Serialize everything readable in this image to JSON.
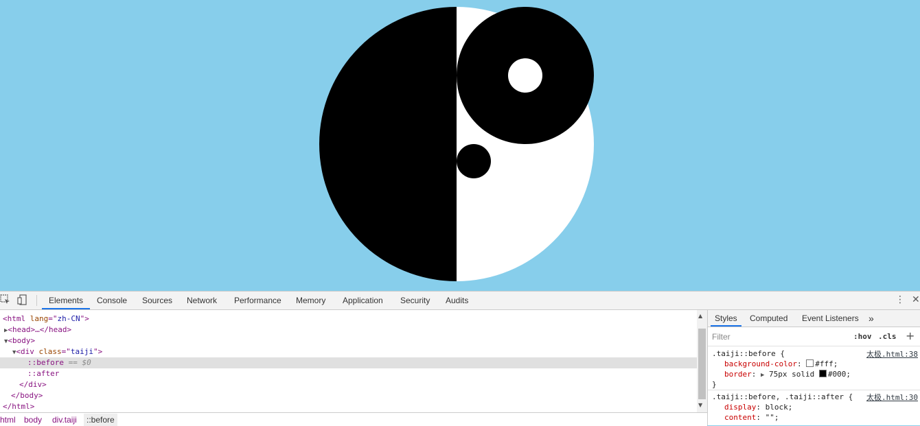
{
  "page": {
    "background_color": "#87ceeb"
  },
  "devtools": {
    "tabs": [
      {
        "label": "Elements",
        "active": true
      },
      {
        "label": "Console",
        "active": false
      },
      {
        "label": "Sources",
        "active": false
      },
      {
        "label": "Network",
        "active": false
      },
      {
        "label": "Performance",
        "active": false
      },
      {
        "label": "Memory",
        "active": false
      },
      {
        "label": "Application",
        "active": false
      },
      {
        "label": "Security",
        "active": false
      },
      {
        "label": "Audits",
        "active": false
      }
    ],
    "dom": {
      "html_open": {
        "tag": "<html",
        "attr": "lang",
        "eq": "=\"",
        "value": "zh-CN",
        "close": "\">"
      },
      "head": "<head>…</head>",
      "body_open": "<body>",
      "div_open": {
        "tag": "<div",
        "attr": "class",
        "eq": "=\"",
        "value": "taiji",
        "close": "\">"
      },
      "before": "::before",
      "before_eq": " == ",
      "before_dollar": "$0",
      "after": "::after",
      "div_close": "</div>",
      "body_close": "</body>",
      "html_close": "</html>"
    },
    "breadcrumb": [
      "html",
      "body",
      "div.taiji",
      "::before"
    ],
    "sidebar": {
      "tabs": [
        "Styles",
        "Computed",
        "Event Listeners"
      ],
      "more": "»",
      "filter_placeholder": "Filter",
      "hov": ":hov",
      "cls": ".cls",
      "add": "+",
      "rules": [
        {
          "selector": ".taiji::before {",
          "source": "太极.html:38",
          "declarations": [
            {
              "prop": "background-color",
              "value": "#fff;",
              "swatch": "#ffffff"
            },
            {
              "prop": "border",
              "value": "75px solid ",
              "value2": "#000;",
              "swatch": "#000000"
            }
          ],
          "close": "}"
        },
        {
          "selector": ".taiji::before, .taiji::after {",
          "source": "太极.html:30",
          "declarations": [
            {
              "prop": "display",
              "value": "block;"
            },
            {
              "prop": "content",
              "value": "\"\";"
            }
          ]
        }
      ]
    }
  }
}
